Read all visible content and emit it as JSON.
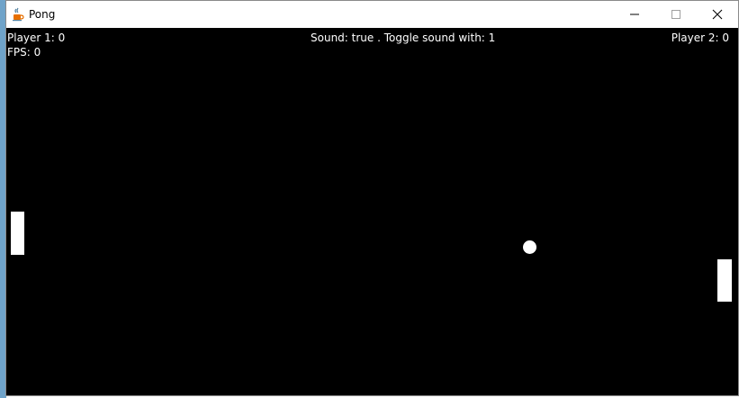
{
  "window": {
    "title": "Pong",
    "app_icon": "java-cup-icon",
    "controls": [
      "minimize-icon",
      "maximize-icon",
      "close-icon"
    ]
  },
  "hud": {
    "player1": "Player 1: 0",
    "player2": "Player 2: 0",
    "fps": "FPS: 0",
    "sound": "Sound: true . Toggle sound with: 1"
  },
  "colors": {
    "canvas": "#000000",
    "foreground": "#ffffff"
  }
}
